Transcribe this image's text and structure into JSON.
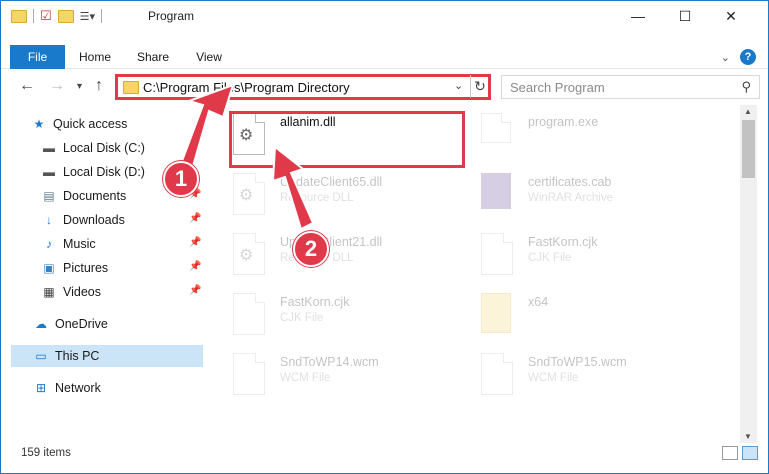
{
  "window": {
    "title": "Program",
    "controls": {
      "minimize": "—",
      "maximize": "☐",
      "close": "✕"
    }
  },
  "ribbon": {
    "tabs": [
      {
        "label": "File"
      },
      {
        "label": "Home"
      },
      {
        "label": "Share"
      },
      {
        "label": "View"
      }
    ]
  },
  "address": {
    "path": "C:\\Program Files\\Program Directory",
    "search_placeholder": "Search Program"
  },
  "sidebar": {
    "items": [
      {
        "label": "Quick access",
        "icon": "star-icon",
        "pinned": false
      },
      {
        "label": "Local Disk (C:)",
        "icon": "drive-icon",
        "pinned": false
      },
      {
        "label": "Local Disk (D:)",
        "icon": "drive-icon",
        "pinned": false
      },
      {
        "label": "Documents",
        "icon": "documents-icon",
        "pinned": true
      },
      {
        "label": "Downloads",
        "icon": "downloads-icon",
        "pinned": true
      },
      {
        "label": "Music",
        "icon": "music-icon",
        "pinned": true
      },
      {
        "label": "Pictures",
        "icon": "pictures-icon",
        "pinned": true
      },
      {
        "label": "Videos",
        "icon": "videos-icon",
        "pinned": true
      },
      {
        "label": "OneDrive",
        "icon": "onedrive-icon",
        "pinned": false
      },
      {
        "label": "This PC",
        "icon": "pc-icon",
        "pinned": false,
        "selected": true
      },
      {
        "label": "Network",
        "icon": "network-icon",
        "pinned": false
      }
    ]
  },
  "files": [
    {
      "name": "allanim.dll",
      "type": "",
      "icon": "dll-file-icon"
    },
    {
      "name": "program.exe",
      "type": "",
      "icon": "exe-file-icon"
    },
    {
      "name": "UpdateClient65.dll",
      "type": "Resource DLL",
      "icon": "dll-file-icon"
    },
    {
      "name": "certificates.cab",
      "type": "WinRAR Archive",
      "icon": "archive-icon"
    },
    {
      "name": "UpdateClient21.dll",
      "type": "Resource DLL",
      "icon": "dll-file-icon"
    },
    {
      "name": "FastKorn.cjk",
      "type": "CJK File",
      "icon": "file-icon"
    },
    {
      "name": "FastKorn.cjk",
      "type": "CJK File",
      "icon": "file-icon"
    },
    {
      "name": "x64",
      "type": "",
      "icon": "folder-icon"
    },
    {
      "name": "SndToWP14.wcm",
      "type": "WCM File",
      "icon": "file-icon"
    },
    {
      "name": "SndToWP15.wcm",
      "type": "WCM File",
      "icon": "file-icon"
    }
  ],
  "status": {
    "item_count": "159 items"
  },
  "annotations": {
    "step1": "1",
    "step2": "2"
  },
  "colors": {
    "accent": "#1979ca",
    "highlight": "#e0394a",
    "selected": "#cce4f7"
  }
}
